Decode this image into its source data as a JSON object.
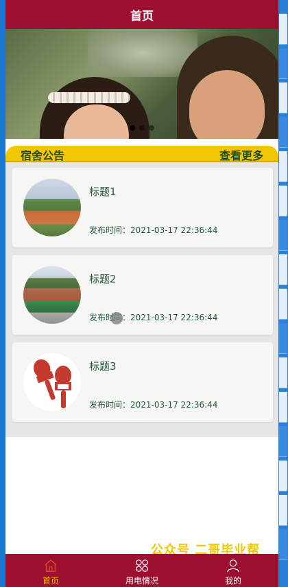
{
  "header": {
    "title": "首页"
  },
  "banner": {
    "slides": 3,
    "active_slide": 1
  },
  "notice": {
    "title": "宿舍公告",
    "more_label": "查看更多"
  },
  "posts": [
    {
      "title": "标题1",
      "time": "发布时间：2021-03-17 22:36:44",
      "thumb": "campus-field-photo"
    },
    {
      "title": "标题2",
      "time": "发布时间：2021-03-17 22:36:44",
      "thumb": "campus-aerial-photo"
    },
    {
      "title": "标题3",
      "time": "发布时间：2021-03-17 22:36:44",
      "thumb": "news-live-microphones"
    }
  ],
  "watermark": "公众号 二哥毕业帮",
  "tabs": [
    {
      "label": "首页",
      "icon": "home-icon",
      "active": true
    },
    {
      "label": "用电情况",
      "icon": "grid-icon",
      "active": false
    },
    {
      "label": "我的",
      "icon": "user-icon",
      "active": false
    }
  ],
  "colors": {
    "brand": "#9c0f2f",
    "accent": "#f2c600",
    "text_green": "#235a3c"
  }
}
